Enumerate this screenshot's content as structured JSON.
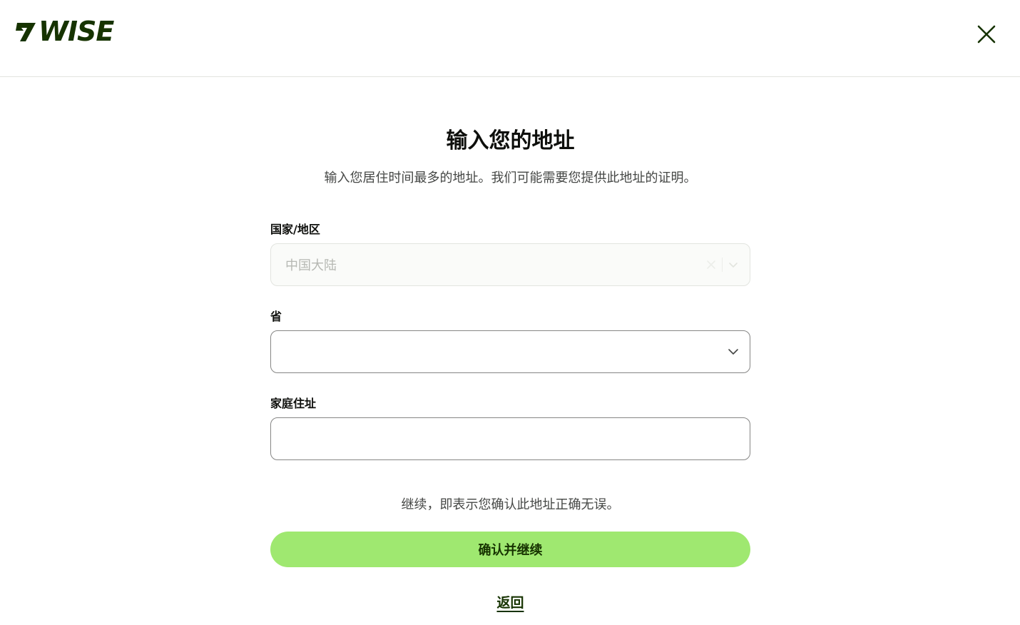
{
  "brand": {
    "name": "wise",
    "accent_color": "#9fe870",
    "forest_color": "#163300"
  },
  "header": {
    "logo_text": "WISE",
    "close_icon": "close-icon"
  },
  "main": {
    "title": "输入您的地址",
    "subtitle": "输入您居住时间最多的地址。我们可能需要您提供此地址的证明。",
    "fields": {
      "country": {
        "label": "国家/地区",
        "value": "中国大陆",
        "disabled": true
      },
      "province": {
        "label": "省",
        "value": ""
      },
      "address": {
        "label": "家庭住址",
        "value": ""
      }
    },
    "notice": "继续，即表示您确认此地址正确无误。",
    "confirm_button": "确认并继续",
    "back_link": "返回"
  }
}
